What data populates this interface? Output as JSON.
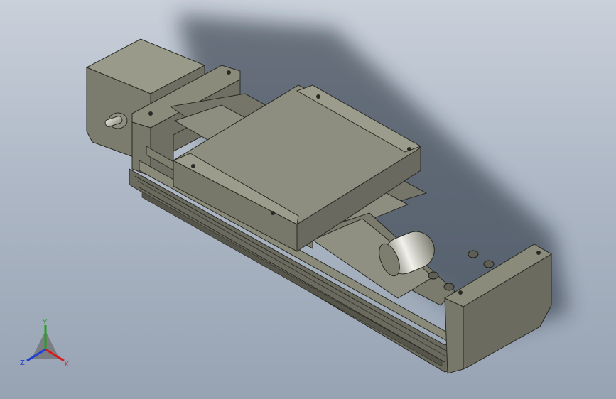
{
  "viewport": {
    "background_top": "#c9d0da",
    "background_bottom": "#97a3b3",
    "model_color": "#7a7a6c"
  },
  "triad": {
    "x_label": "X",
    "y_label": "Y",
    "z_label": "Z",
    "x_color": "#d21f1f",
    "y_color": "#1fa21f",
    "z_color": "#1f3fd2"
  }
}
